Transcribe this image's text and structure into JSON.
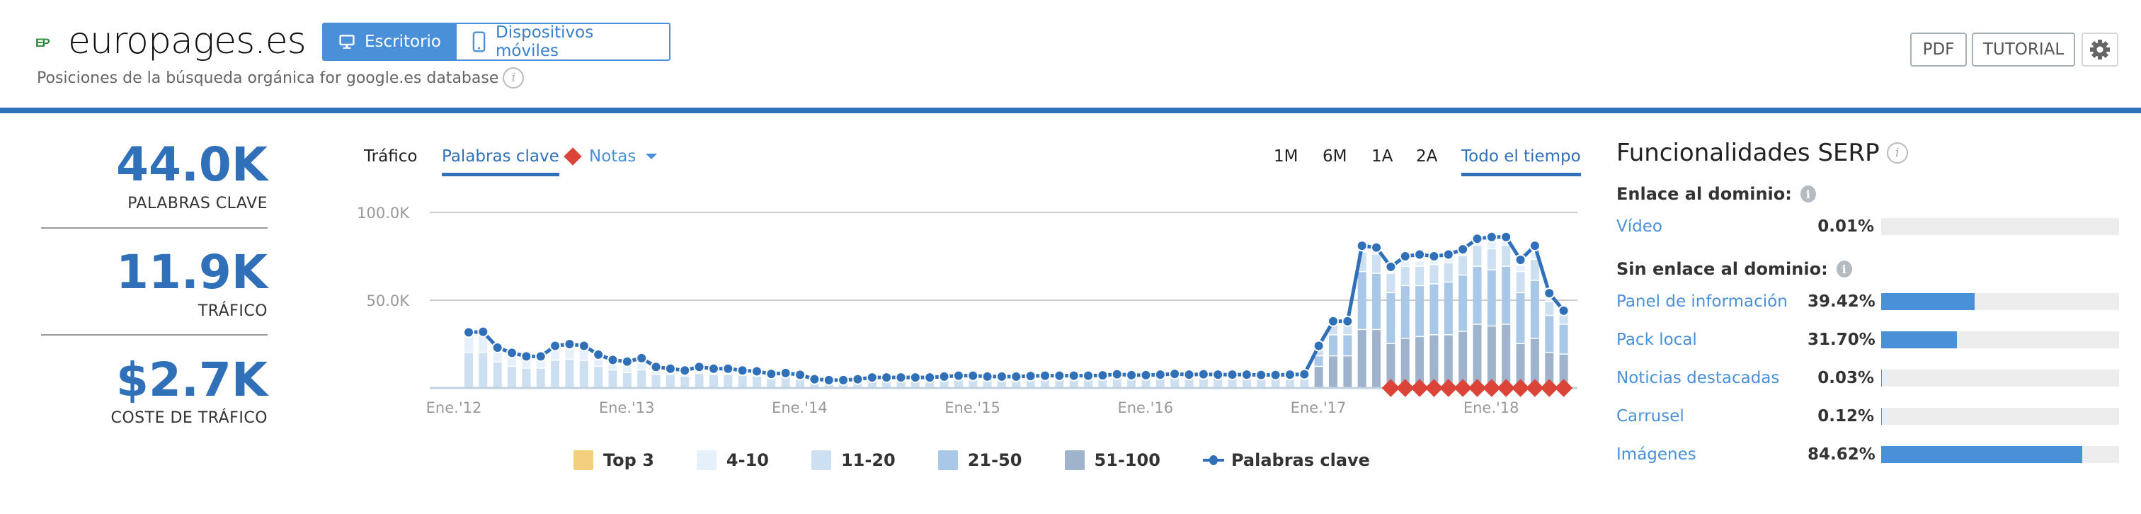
{
  "header": {
    "logo_text": "EP",
    "site_title": "europages.es",
    "subtitle": "Posiciones de la búsqueda orgánica for google.es database",
    "device_toggle": [
      {
        "label": "Escritorio",
        "icon": "desktop-icon",
        "active": true
      },
      {
        "label": "Dispositivos móviles",
        "icon": "mobile-icon",
        "active": false
      }
    ],
    "buttons": {
      "pdf": "PDF",
      "tutorial": "TUTORIAL",
      "settings_icon": "gear-icon"
    },
    "accent_color": "#3070b8"
  },
  "stats": [
    {
      "value": "44.0K",
      "label": "PALABRAS CLAVE"
    },
    {
      "value": "11.9K",
      "label": "TRÁFICO"
    },
    {
      "value": "$2.7K",
      "label": "COSTE DE TRÁFICO"
    }
  ],
  "chart_controls": {
    "tabs": [
      {
        "label": "Tráfico",
        "active": false
      },
      {
        "label": "Palabras clave",
        "active": true
      }
    ],
    "notes_label": "Notas",
    "ranges": [
      {
        "label": "1M",
        "active": false
      },
      {
        "label": "6M",
        "active": false
      },
      {
        "label": "1A",
        "active": false
      },
      {
        "label": "2A",
        "active": false
      },
      {
        "label": "Todo el tiempo",
        "active": true
      }
    ]
  },
  "chart_data": {
    "type": "bar",
    "title": "",
    "xlabel": "",
    "ylabel": "",
    "ylim": [
      0,
      100000
    ],
    "yticks": [
      {
        "value": 50000,
        "label": "50.0K"
      },
      {
        "value": 100000,
        "label": "100.0K"
      }
    ],
    "grid": true,
    "legend_position": "bottom",
    "start_month": "2012-02",
    "xtick_labels": [
      {
        "label": "Ene.'12",
        "month_index": -1
      },
      {
        "label": "Ene.'13",
        "month_index": 11
      },
      {
        "label": "Ene.'14",
        "month_index": 23
      },
      {
        "label": "Ene.'15",
        "month_index": 35
      },
      {
        "label": "Ene.'16",
        "month_index": 47
      },
      {
        "label": "Ene.'17",
        "month_index": 59
      },
      {
        "label": "Ene.'18",
        "month_index": 71
      }
    ],
    "series": [
      {
        "name": "Top 3",
        "color": "#f3cf7e"
      },
      {
        "name": "4-10",
        "color": "#e6f0fa"
      },
      {
        "name": "11-20",
        "color": "#cde0f2"
      },
      {
        "name": "21-50",
        "color": "#a9c7e6"
      },
      {
        "name": "51-100",
        "color": "#9fb4cc"
      }
    ],
    "line_series": {
      "name": "Palabras clave",
      "color": "#3070b8",
      "values": [
        31700,
        32000,
        23000,
        20000,
        18000,
        18000,
        24000,
        25000,
        24000,
        19000,
        16000,
        15000,
        17000,
        12000,
        11000,
        10000,
        12000,
        11000,
        11000,
        10000,
        9500,
        8000,
        8500,
        7500,
        5000,
        4500,
        4500,
        5000,
        6000,
        6000,
        6000,
        6000,
        6000,
        6500,
        7000,
        7000,
        6500,
        6500,
        6500,
        6800,
        7000,
        7000,
        7000,
        7000,
        7200,
        7800,
        7300,
        7300,
        7600,
        8000,
        7600,
        7800,
        7600,
        7600,
        7600,
        7400,
        7400,
        7600,
        7800,
        24000,
        38000,
        38000,
        81000,
        80000,
        69000,
        75000,
        76000,
        75000,
        76000,
        79000,
        85000,
        86000,
        86000,
        73000,
        81000,
        54000,
        44000
      ]
    },
    "stacked_values": {
      "top3": [
        0,
        800,
        0,
        0,
        0,
        0,
        0,
        0,
        0,
        0,
        0,
        0,
        0,
        0,
        0,
        0,
        0,
        0,
        0,
        0,
        0,
        0,
        0,
        0,
        0,
        0,
        0,
        0,
        0,
        0,
        0,
        0,
        0,
        0,
        0,
        0,
        0,
        0,
        0,
        0,
        0,
        0,
        0,
        0,
        0,
        0,
        0,
        0,
        0,
        0,
        0,
        0,
        0,
        0,
        0,
        0,
        0,
        0,
        0,
        0,
        0,
        0,
        0,
        0,
        0,
        0,
        0,
        0,
        0,
        0,
        0,
        0,
        0,
        0,
        0,
        0,
        0
      ],
      "r4_10": [
        11500,
        10000,
        8500,
        8000,
        6000,
        6000,
        8000,
        8000,
        8000,
        6000,
        5000,
        4500,
        5000,
        2500,
        2500,
        2500,
        2500,
        2500,
        2500,
        2000,
        2000,
        1500,
        1500,
        1500,
        500,
        500,
        500,
        500,
        500,
        500,
        500,
        500,
        500,
        500,
        500,
        500,
        500,
        500,
        500,
        500,
        500,
        500,
        500,
        500,
        500,
        500,
        500,
        500,
        500,
        500,
        500,
        500,
        500,
        500,
        500,
        500,
        500,
        500,
        500,
        1500,
        2000,
        2000,
        4000,
        4000,
        3500,
        3000,
        3000,
        3000,
        3000,
        3500,
        4000,
        4000,
        3800,
        3500,
        4000,
        2500,
        2000
      ],
      "r11_20": [
        20000,
        20000,
        14500,
        12000,
        11000,
        11000,
        15500,
        16000,
        15500,
        12000,
        10000,
        8500,
        10000,
        7500,
        7500,
        6500,
        8000,
        7500,
        7500,
        7000,
        6500,
        5500,
        6000,
        5000,
        3000,
        2800,
        2800,
        3000,
        4000,
        4000,
        4000,
        4000,
        4000,
        4500,
        5000,
        5000,
        4500,
        4500,
        4500,
        5000,
        5000,
        5000,
        5000,
        5000,
        5000,
        6000,
        5000,
        5000,
        5500,
        6000,
        5500,
        5500,
        5500,
        5500,
        5500,
        5500,
        5500,
        5500,
        5500,
        4000,
        6000,
        6000,
        11000,
        11000,
        11000,
        11000,
        11000,
        11000,
        11000,
        11000,
        12000,
        12000,
        12000,
        12000,
        12000,
        8000,
        6000
      ],
      "r21_50": [
        0,
        0,
        0,
        0,
        0,
        0,
        0,
        0,
        0,
        0,
        0,
        0,
        0,
        0,
        0,
        0,
        0,
        0,
        0,
        0,
        0,
        0,
        0,
        0,
        0,
        0,
        0,
        0,
        0,
        0,
        0,
        0,
        0,
        0,
        0,
        0,
        0,
        0,
        0,
        0,
        0,
        0,
        0,
        0,
        0,
        0,
        0,
        0,
        0,
        0,
        0,
        0,
        0,
        0,
        0,
        0,
        0,
        0,
        0,
        6000,
        12000,
        12000,
        33000,
        32000,
        29000,
        30000,
        29000,
        29000,
        30000,
        32000,
        33000,
        32000,
        33000,
        29000,
        33000,
        21000,
        17000
      ],
      "r51_100": [
        0,
        0,
        0,
        0,
        0,
        0,
        0,
        0,
        0,
        0,
        0,
        0,
        0,
        0,
        0,
        0,
        0,
        0,
        0,
        0,
        0,
        0,
        0,
        0,
        0,
        0,
        0,
        0,
        0,
        0,
        0,
        0,
        0,
        0,
        0,
        0,
        0,
        0,
        0,
        0,
        0,
        0,
        0,
        0,
        0,
        0,
        0,
        0,
        0,
        0,
        0,
        0,
        0,
        0,
        0,
        0,
        0,
        0,
        0,
        12000,
        18000,
        18000,
        33000,
        33000,
        25000,
        28000,
        29000,
        30000,
        30000,
        32000,
        36000,
        35000,
        36000,
        25000,
        28000,
        20000,
        19000
      ]
    },
    "notes_markers_month_index": [
      64,
      65,
      66,
      67,
      68,
      69,
      70,
      71,
      72,
      73,
      74,
      75,
      76
    ]
  },
  "legend": [
    {
      "label": "Top 3",
      "color": "#f3cf7e"
    },
    {
      "label": "4-10",
      "color": "#e6f0fa"
    },
    {
      "label": "11-20",
      "color": "#cde0f2"
    },
    {
      "label": "21-50",
      "color": "#a9c7e6"
    },
    {
      "label": "51-100",
      "color": "#9fb4cc"
    },
    {
      "label": "Palabras clave",
      "color": "#3070b8",
      "type": "line"
    }
  ],
  "serp": {
    "title": "Funcionalidades SERP",
    "linked_heading": "Enlace al dominio:",
    "linked": [
      {
        "name": "Vídeo",
        "pct_label": "0.01%",
        "pct": 0.01
      }
    ],
    "unlinked_heading": "Sin enlace al dominio:",
    "unlinked": [
      {
        "name": "Panel de información",
        "pct_label": "39.42%",
        "pct": 39.42
      },
      {
        "name": "Pack local",
        "pct_label": "31.70%",
        "pct": 31.7
      },
      {
        "name": "Noticias destacadas",
        "pct_label": "0.03%",
        "pct": 0.03
      },
      {
        "name": "Carrusel",
        "pct_label": "0.12%",
        "pct": 0.12
      },
      {
        "name": "Imágenes",
        "pct_label": "84.62%",
        "pct": 84.62
      }
    ],
    "bar_color": "#4a90d9",
    "track_color": "#ededed"
  }
}
